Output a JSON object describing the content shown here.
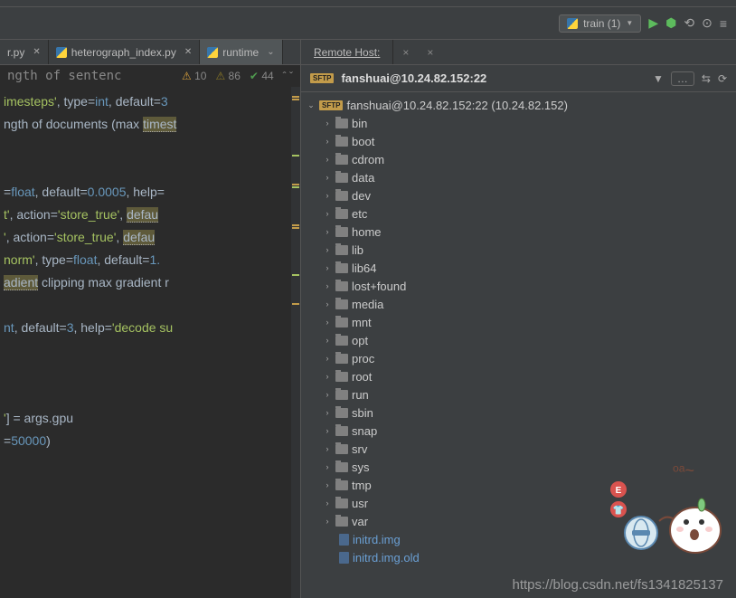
{
  "toolbar": {
    "run_config": "train (1)",
    "run_count_arrow": "▼"
  },
  "tabs": [
    {
      "label": "r.py",
      "active": false
    },
    {
      "label": "heterograph_index.py",
      "active": false
    },
    {
      "label": "runtime",
      "active": true
    }
  ],
  "status": {
    "text": "ngth of sentenc",
    "warn": "10",
    "warn2": "86",
    "ok": "44"
  },
  "code_lines": [
    "imesteps', type=int, default=3",
    "ngth of documents (max timest",
    "",
    "",
    "=float, default=0.0005, help=",
    "t', action='store_true', defau",
    "', action='store_true', defau",
    "norm', type=float, default=1.",
    "adient clipping max gradient r",
    "",
    "nt, default=3, help='decode su",
    "",
    "",
    "",
    "'] = args.gpu",
    "=50000)"
  ],
  "remote_host": {
    "tab_label": "Remote Host:",
    "title": "fanshuai@10.24.82.152:22",
    "root_label": "fanshuai@10.24.82.152:22 (10.24.82.152)",
    "folders": [
      "bin",
      "boot",
      "cdrom",
      "data",
      "dev",
      "etc",
      "home",
      "lib",
      "lib64",
      "lost+found",
      "media",
      "mnt",
      "opt",
      "proc",
      "root",
      "run",
      "sbin",
      "snap",
      "srv",
      "sys",
      "tmp",
      "usr",
      "var"
    ],
    "files": [
      "initrd.img",
      "initrd.img.old"
    ]
  },
  "watermark": "https://blog.csdn.net/fs1341825137"
}
